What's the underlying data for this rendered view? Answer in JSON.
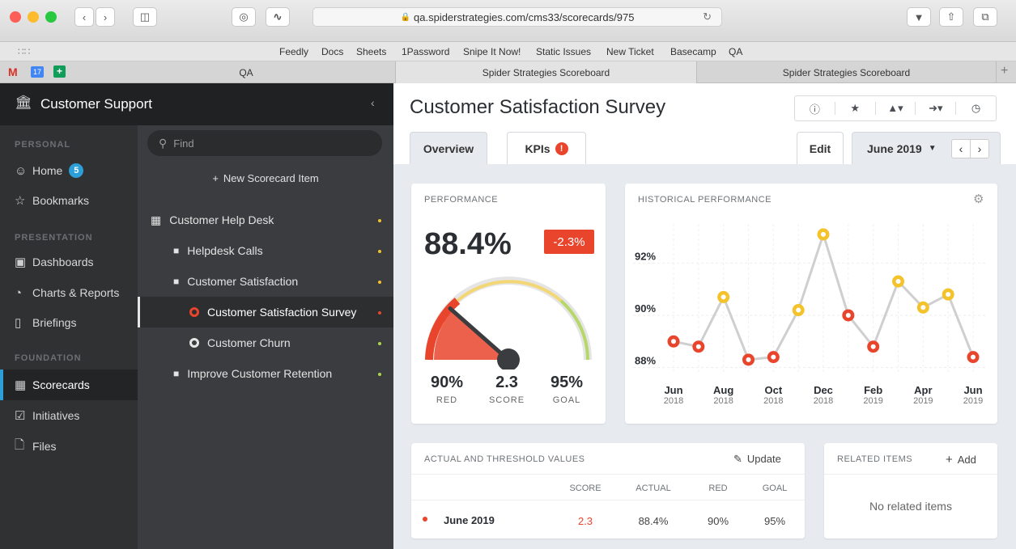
{
  "browser": {
    "url": "qa.spiderstrategies.com/cms33/scorecards/975",
    "bookmarks": [
      "Feedly",
      "Docs",
      "Sheets",
      "1Password",
      "Snipe It Now!",
      "Static Issues",
      "New Ticket",
      "Basecamp",
      "QA"
    ],
    "tabs": [
      "QA",
      "Spider Strategies Scoreboard",
      "Spider Strategies Scoreboard"
    ],
    "calendar_badge": "17"
  },
  "nav": {
    "title": "Customer Support",
    "sections": {
      "personal": "PERSONAL",
      "presentation": "PRESENTATION",
      "foundation": "FOUNDATION"
    },
    "items": {
      "home": "Home",
      "home_badge": "5",
      "bookmarks": "Bookmarks",
      "dashboards": "Dashboards",
      "charts": "Charts & Reports",
      "briefings": "Briefings",
      "scorecards": "Scorecards",
      "initiatives": "Initiatives",
      "files": "Files"
    }
  },
  "tree": {
    "search_placeholder": "Find",
    "new_item": "New Scorecard Item",
    "items": [
      "Customer Help Desk",
      "Helpdesk Calls",
      "Customer Satisfaction",
      "Customer Satisfaction Survey",
      "Customer Churn",
      "Improve Customer Retention"
    ]
  },
  "page": {
    "title": "Customer Satisfaction Survey",
    "tabs": {
      "overview": "Overview",
      "kpis": "KPIs"
    },
    "edit": "Edit",
    "period": "June 2019"
  },
  "performance": {
    "title": "PERFORMANCE",
    "value": "88.4%",
    "change": "-2.3%",
    "red_value": "90%",
    "red_label": "RED",
    "score_value": "2.3",
    "score_label": "SCORE",
    "goal_value": "95%",
    "goal_label": "GOAL",
    "gauge_fraction": 0.23
  },
  "history": {
    "title": "HISTORICAL PERFORMANCE",
    "y_ticks": [
      "92%",
      "90%",
      "88%"
    ],
    "x_ticks": [
      {
        "m": "Jun",
        "y": "2018"
      },
      {
        "m": "Aug",
        "y": "2018"
      },
      {
        "m": "Oct",
        "y": "2018"
      },
      {
        "m": "Dec",
        "y": "2018"
      },
      {
        "m": "Feb",
        "y": "2019"
      },
      {
        "m": "Apr",
        "y": "2019"
      },
      {
        "m": "Jun",
        "y": "2019"
      }
    ]
  },
  "chart_data": {
    "type": "line",
    "x": [
      "Jun 2018",
      "Jul 2018",
      "Aug 2018",
      "Sep 2018",
      "Oct 2018",
      "Nov 2018",
      "Dec 2018",
      "Jan 2019",
      "Feb 2019",
      "Mar 2019",
      "Apr 2019",
      "May 2019",
      "Jun 2019"
    ],
    "values": [
      89.0,
      88.8,
      90.7,
      88.3,
      88.4,
      90.2,
      93.1,
      90.0,
      88.8,
      91.3,
      90.3,
      90.8,
      88.4
    ],
    "status": [
      "red",
      "red",
      "yellow",
      "red",
      "red",
      "yellow",
      "yellow",
      "red",
      "red",
      "yellow",
      "yellow",
      "yellow",
      "red"
    ],
    "ylim": [
      87.8,
      93.5
    ],
    "colors": {
      "red": "#e8452c",
      "yellow": "#f4c22b",
      "line": "#cfcfcf"
    }
  },
  "thresholds": {
    "title": "ACTUAL AND THRESHOLD VALUES",
    "update": "Update",
    "columns": [
      "SCORE",
      "ACTUAL",
      "RED",
      "GOAL"
    ],
    "row": {
      "label": "June 2019",
      "score": "2.3",
      "actual": "88.4%",
      "red": "90%",
      "goal": "95%"
    }
  },
  "related": {
    "title": "RELATED ITEMS",
    "add": "Add",
    "empty": "No related items"
  }
}
